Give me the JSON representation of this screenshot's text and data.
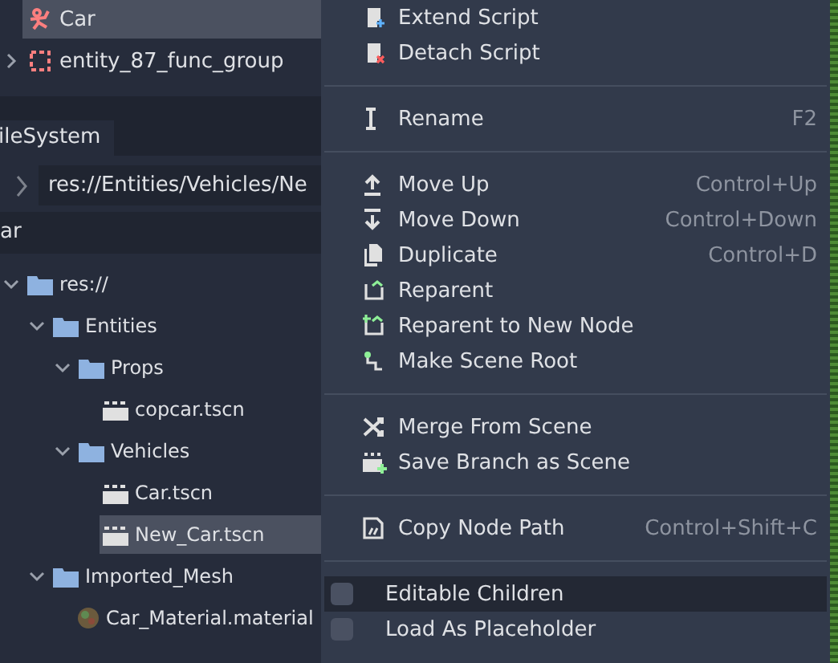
{
  "scene_tree": {
    "items": [
      {
        "label": "Car",
        "kind": "car",
        "selected": true
      },
      {
        "label": "entity_87_func_group",
        "kind": "group",
        "selected": false,
        "expandable": true,
        "expanded": false
      }
    ]
  },
  "filesystem": {
    "tab": {
      "label": "ileSystem",
      "selected": true
    },
    "path": "res://Entities/Vehicles/Ne",
    "filter": {
      "value": "ar"
    },
    "tree": [
      {
        "label": "res://",
        "kind": "folder",
        "selected": false,
        "expanded": true,
        "children": [
          {
            "label": "Entities",
            "kind": "folder",
            "selected": false,
            "expanded": true,
            "children": [
              {
                "label": "Props",
                "kind": "folder",
                "selected": false,
                "expanded": true,
                "children": [
                  {
                    "label": "copcar.tscn",
                    "kind": "scene",
                    "selected": false
                  }
                ]
              },
              {
                "label": "Vehicles",
                "kind": "folder",
                "selected": false,
                "expanded": true,
                "children": [
                  {
                    "label": "Car.tscn",
                    "kind": "scene",
                    "selected": false
                  },
                  {
                    "label": "New_Car.tscn",
                    "kind": "scene",
                    "selected": true
                  }
                ]
              }
            ]
          },
          {
            "label": "Imported_Mesh",
            "kind": "folder",
            "selected": false,
            "expanded": true,
            "children": [
              {
                "label": "Car_Material.material",
                "kind": "material",
                "selected": false
              }
            ]
          }
        ]
      }
    ]
  },
  "context_menu": {
    "items": [
      {
        "kind": "action",
        "label": "Extend Script"
      },
      {
        "kind": "action",
        "label": "Detach Script"
      },
      {
        "kind": "separator"
      },
      {
        "kind": "action",
        "label": "Rename",
        "shortcut": "F2"
      },
      {
        "kind": "separator"
      },
      {
        "kind": "action",
        "label": "Move Up",
        "shortcut": "Control+Up"
      },
      {
        "kind": "action",
        "label": "Move Down",
        "shortcut": "Control+Down"
      },
      {
        "kind": "action",
        "label": "Duplicate",
        "shortcut": "Control+D"
      },
      {
        "kind": "action",
        "label": "Reparent"
      },
      {
        "kind": "action",
        "label": "Reparent to New Node"
      },
      {
        "kind": "action",
        "label": "Make Scene Root"
      },
      {
        "kind": "separator"
      },
      {
        "kind": "action",
        "label": "Merge From Scene"
      },
      {
        "kind": "action",
        "label": "Save Branch as Scene"
      },
      {
        "kind": "separator"
      },
      {
        "kind": "action",
        "label": "Copy Node Path",
        "shortcut": "Control+Shift+C"
      },
      {
        "kind": "separator"
      },
      {
        "kind": "check",
        "label": "Editable Children",
        "checked": false,
        "highlighted": true
      },
      {
        "kind": "check",
        "label": "Load As Placeholder",
        "checked": false,
        "highlighted": false
      }
    ]
  }
}
